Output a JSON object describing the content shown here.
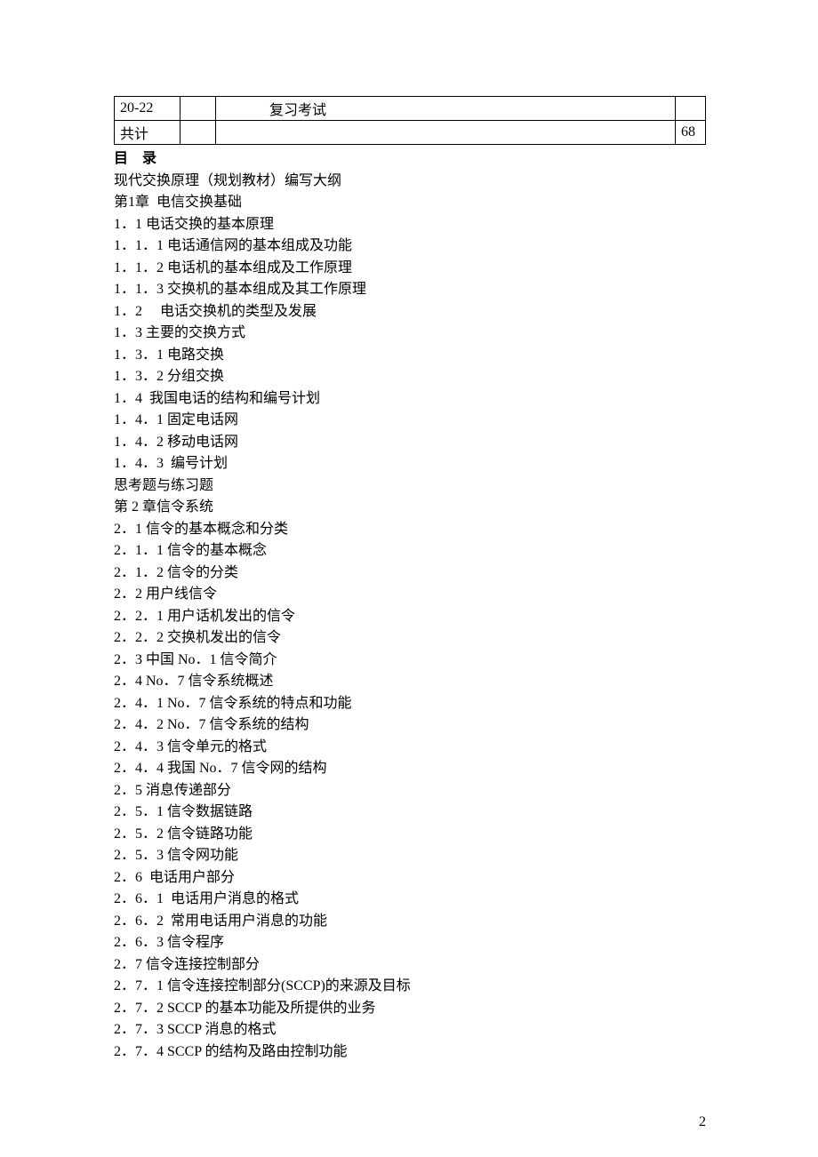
{
  "table": {
    "rows": [
      {
        "c1": "20-22",
        "c2": "",
        "c3": "复习考试",
        "c4": ""
      },
      {
        "c1": "共计",
        "c2": "",
        "c3": "",
        "c4": "68"
      }
    ]
  },
  "toc_title": "目录",
  "toc": [
    "现代交换原理（规划教材）编写大纲",
    "第1章  电信交换基础",
    "1．1 电话交换的基本原理",
    "1．1．1 电话通信网的基本组成及功能",
    "1．1．2 电话机的基本组成及工作原理",
    "1．1．3 交换机的基本组成及其工作原理",
    "1．2 　电话交换机的类型及发展",
    "1．3 主要的交换方式",
    "1．3．1 电路交换",
    "1．3．2 分组交换",
    "1．4  我国电话的结构和编号计划",
    "1．4．1 固定电话网",
    "1．4．2 移动电话网",
    "1．4．3  编号计划",
    "思考题与练习题",
    "第 2 章信令系统",
    "2．1 信令的基本概念和分类",
    "2．1．1 信令的基本概念",
    "2．1．2 信令的分类",
    "2．2 用户线信令",
    "2．2．1 用户话机发出的信令",
    "2．2．2 交换机发出的信令",
    "2．3 中国 No．1 信令简介",
    "2．4 No．7 信令系统概述",
    "2．4．1 No．7 信令系统的特点和功能",
    "2．4．2 No．7 信令系统的结构",
    "2．4．3 信令单元的格式",
    "2．4．4 我国 No．7 信令网的结构",
    "2．5 消息传递部分",
    "2．5．1 信令数据链路",
    "2．5．2 信令链路功能",
    "2．5．3 信令网功能",
    "2．6  电话用户部分",
    "2．6．1  电话用户消息的格式",
    "2．6．2  常用电话用户消息的功能",
    "2．6．3 信令程序",
    "2．7 信令连接控制部分",
    "2．7．1 信令连接控制部分(SCCP)的来源及目标",
    "2．7．2 SCCP 的基本功能及所提供的业务",
    "2．7．3 SCCP 消息的格式",
    "2．7．4 SCCP 的结构及路由控制功能"
  ],
  "page_number": "2"
}
